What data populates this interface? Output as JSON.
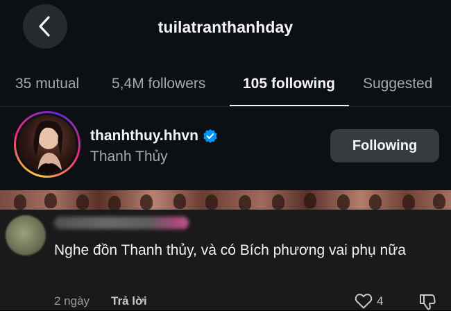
{
  "header": {
    "title": "tuilatranthanhday",
    "back_icon": "chevron-left-icon"
  },
  "tabs": [
    {
      "label": "35 mutual",
      "active": false
    },
    {
      "label": "5,4M followers",
      "active": false
    },
    {
      "label": "105 following",
      "active": true
    },
    {
      "label": "Suggested",
      "active": false
    }
  ],
  "user": {
    "username": "thanhthuy.hhvn",
    "verified_icon": "verified-badge-icon",
    "full_name": "Thanh Thủy",
    "follow_button_label": "Following"
  },
  "comment": {
    "text": "Nghe đồn Thanh thủy, và có Bích phương vai phụ nữa",
    "time": "2 ngày",
    "reply_label": "Trả lời",
    "like_count": "4"
  },
  "colors": {
    "panel_bg": "#0c1014",
    "button_bg": "#363b40",
    "verified_blue": "#0095f6",
    "comment_bg": "#1a1a1a"
  }
}
